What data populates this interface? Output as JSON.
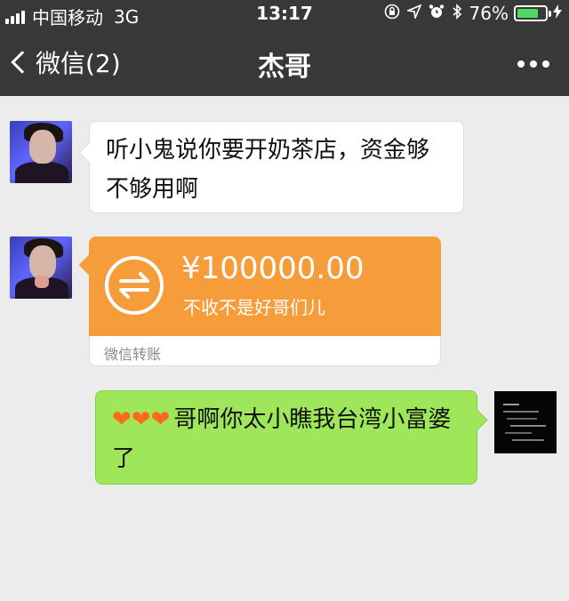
{
  "status_bar": {
    "carrier": "中国移动",
    "network": "3G",
    "time": "13:17",
    "battery": "76%",
    "battery_level": 0.76,
    "battery_color": "#4cd964"
  },
  "nav": {
    "back_label": "微信(2)",
    "title": "杰哥"
  },
  "messages": {
    "m1": {
      "text": "听小鬼说你要开奶茶店，资金够不够用啊"
    },
    "m2": {
      "amount": "¥100000.00",
      "note": "不收不是好哥们儿",
      "footer": "微信转账",
      "color": "#f79c3a"
    },
    "m3": {
      "hearts": "❤❤❤",
      "text": "哥啊你太小瞧我台湾小富婆了"
    }
  },
  "colors": {
    "bar_bg": "#383838",
    "chat_bg": "#ececec",
    "self_bubble": "#9fe65a"
  },
  "icons": [
    "signal-icon",
    "lock-rotation-icon",
    "location-arrow-icon",
    "alarm-icon",
    "bluetooth-icon",
    "battery-icon",
    "charging-icon",
    "chevron-left-icon",
    "more-dots-icon",
    "transfer-icon",
    "heart-emoji"
  ]
}
